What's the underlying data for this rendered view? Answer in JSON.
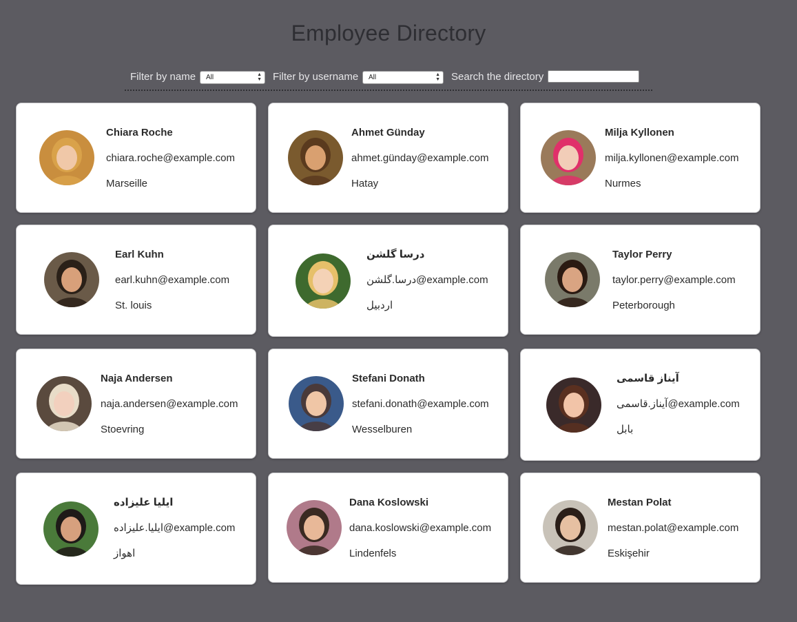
{
  "header": {
    "title": "Employee Directory"
  },
  "filters": {
    "name_label": "Filter by name",
    "name_value": "All",
    "username_label": "Filter by username",
    "username_value": "All",
    "search_label": "Search the directory",
    "search_value": ""
  },
  "employees": [
    {
      "name": "Chiara Roche",
      "email": "chiara.roche@example.com",
      "city": "Marseille",
      "avatar_bg": "#c98e3e",
      "avatar_hair": "#d9a24a",
      "avatar_skin": "#f0c8a8"
    },
    {
      "name": "Ahmet Günday",
      "email": "ahmet.günday@example.com",
      "city": "Hatay",
      "avatar_bg": "#7a5a2e",
      "avatar_hair": "#5a3a1e",
      "avatar_skin": "#d9a070"
    },
    {
      "name": "Milja Kyllonen",
      "email": "milja.kyllonen@example.com",
      "city": "Nurmes",
      "avatar_bg": "#9a7a5a",
      "avatar_hair": "#e0306a",
      "avatar_skin": "#f2cdb8"
    },
    {
      "name": "Earl Kuhn",
      "email": "earl.kuhn@example.com",
      "city": "St. louis",
      "avatar_bg": "#6a5a48",
      "avatar_hair": "#2a2018",
      "avatar_skin": "#d8a07a"
    },
    {
      "name": "درسا گلشن",
      "email": "درسا.گلشن@example.com",
      "city": "اردبیل",
      "avatar_bg": "#3e6a2e",
      "avatar_hair": "#e6c06a",
      "avatar_skin": "#f4d2b6"
    },
    {
      "name": "Taylor Perry",
      "email": "taylor.perry@example.com",
      "city": "Peterborough",
      "avatar_bg": "#7a7a6a",
      "avatar_hair": "#2a1a12",
      "avatar_skin": "#d9a482"
    },
    {
      "name": "Naja Andersen",
      "email": "naja.andersen@example.com",
      "city": "Stoevring",
      "avatar_bg": "#5a4a3e",
      "avatar_hair": "#e8dcc8",
      "avatar_skin": "#f2d0be"
    },
    {
      "name": "Stefani Donath",
      "email": "stefani.donath@example.com",
      "city": "Wesselburen",
      "avatar_bg": "#3a5a8a",
      "avatar_hair": "#4a3a3a",
      "avatar_skin": "#f0c6a6"
    },
    {
      "name": "آیناز قاسمی",
      "email": "آیناز.قاسمی@example.com",
      "city": "بابل",
      "avatar_bg": "#3a2a2a",
      "avatar_hair": "#5a3020",
      "avatar_skin": "#f2c4a8"
    },
    {
      "name": "ایلیا علیزاده",
      "email": "ایلیا.علیزاده@example.com",
      "city": "اهواز",
      "avatar_bg": "#4a7a3a",
      "avatar_hair": "#1e1a18",
      "avatar_skin": "#d6a07e"
    },
    {
      "name": "Dana Koslowski",
      "email": "dana.koslowski@example.com",
      "city": "Lindenfels",
      "avatar_bg": "#b07a8a",
      "avatar_hair": "#3a2a22",
      "avatar_skin": "#e8b898"
    },
    {
      "name": "Mestan Polat",
      "email": "mestan.polat@example.com",
      "city": "Eskişehir",
      "avatar_bg": "#c8c2b8",
      "avatar_hair": "#2a1e18",
      "avatar_skin": "#e6c0a2"
    }
  ]
}
